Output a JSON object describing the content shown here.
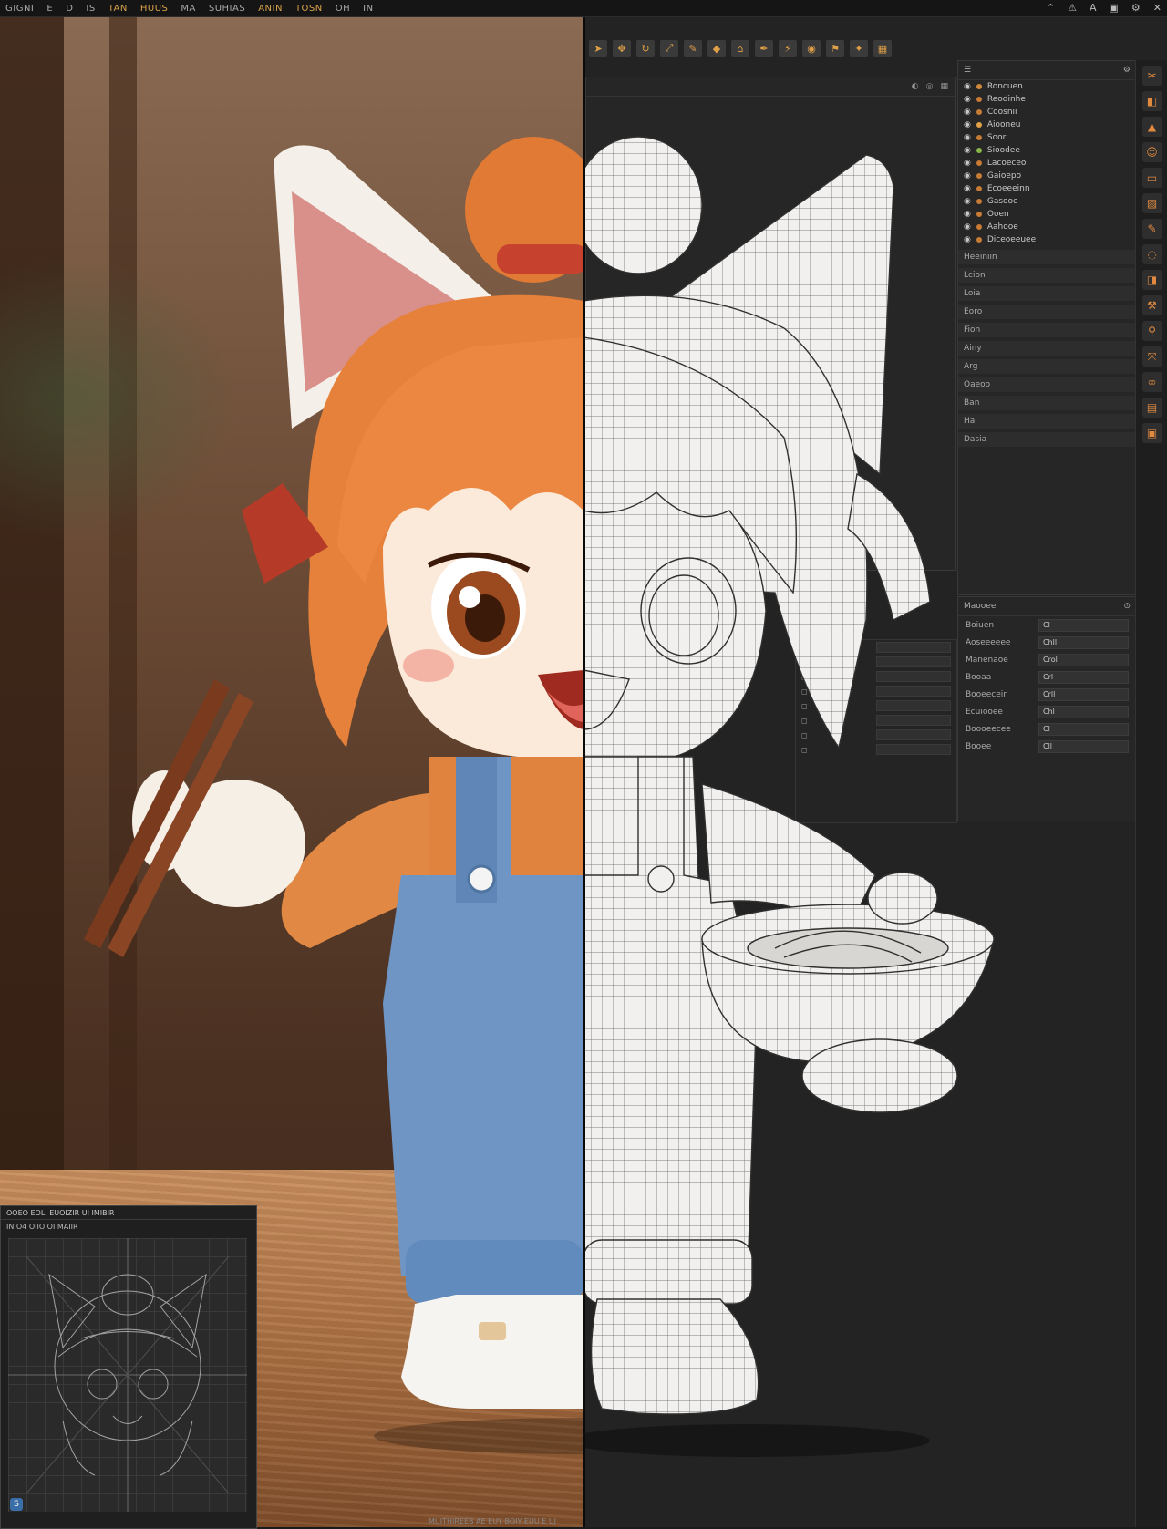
{
  "menu": {
    "items": [
      "GIGNI",
      "E",
      "D",
      "IS",
      "TAN",
      "HUUS",
      "MA",
      "SUHIAS",
      "ANIN",
      "TOSN",
      "OH",
      "IN"
    ]
  },
  "top_icons": [
    "chevron-up-icon",
    "alert-icon",
    "font-icon",
    "clipboard-icon",
    "settings-icon",
    "close-icon"
  ],
  "outliner": {
    "rows": [
      {
        "label": "Roncuen",
        "color": "#d08a3a"
      },
      {
        "label": "Reodinhe",
        "color": "#c77b34"
      },
      {
        "label": "Coosnii",
        "color": "#c77b34"
      },
      {
        "label": "Aiooneu",
        "color": "#e0a048"
      },
      {
        "label": "Soor",
        "color": "#c77b34"
      },
      {
        "label": "Sioodee",
        "color": "#8ab848"
      },
      {
        "label": "Lacoeceo",
        "color": "#c77b34"
      },
      {
        "label": "Gaioepo",
        "color": "#c77b34"
      },
      {
        "label": "Ecoeeeinn",
        "color": "#c77b34"
      },
      {
        "label": "Gasooe",
        "color": "#c77b34"
      },
      {
        "label": "Ooen",
        "color": "#c77b34"
      },
      {
        "label": "Aahooe",
        "color": "#c77b34"
      },
      {
        "label": "Diceoeeuee",
        "color": "#c77b34"
      }
    ],
    "sections": [
      "Heeiniin",
      "Lcion",
      "Loia",
      "Eoro",
      "Fion",
      "Ainy",
      "Arg",
      "Oaeoo",
      "Ban",
      "Ha",
      "Dasia"
    ]
  },
  "properties": {
    "title": "Maooee",
    "rows": [
      {
        "label": "Boiuen",
        "value": "Cl"
      },
      {
        "label": "Aoseeeeee",
        "value": "Chll"
      },
      {
        "label": "Manenaoe",
        "value": "Crol"
      },
      {
        "label": "Booaa",
        "value": "Crl"
      },
      {
        "label": "Booeeceir",
        "value": "Crll"
      },
      {
        "label": "Ecuiooee",
        "value": "Chl"
      },
      {
        "label": "Boooeecee",
        "value": "Cl"
      },
      {
        "label": "Booee",
        "value": "Cll"
      }
    ]
  },
  "ortho": {
    "title": "OOEO EOLI EUOIZIR UI IMIBIR",
    "subtitle": "IN O4 OIIO OI MAIIR",
    "corner_badge": "S"
  },
  "status": "MUITHIREEB AE EUY BOIY EUU E UJ"
}
